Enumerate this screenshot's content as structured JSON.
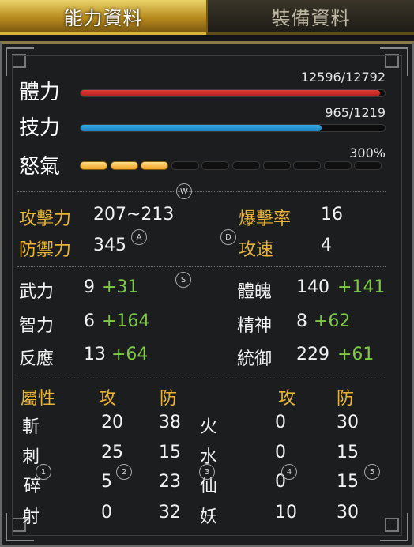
{
  "tabs": [
    {
      "label": "能力資料",
      "active": true
    },
    {
      "label": "裝備資料",
      "active": false
    }
  ],
  "bars": [
    {
      "label": "體力",
      "value": "12596/12792",
      "fraction": 0.985,
      "color": "#e33b3b"
    },
    {
      "label": "技力",
      "value": "965/1219",
      "fraction": 0.792,
      "color": "#37aee8"
    }
  ],
  "rage": {
    "label": "怒氣",
    "value": "300%",
    "segments_total": 10,
    "segments_filled": 3
  },
  "combat": {
    "attack_label": "攻擊力",
    "attack_value": "207~213",
    "crit_label": "爆擊率",
    "crit_value": "16",
    "defense_label": "防禦力",
    "defense_value": "345",
    "speed_label": "攻速",
    "speed_value": "4"
  },
  "attributes": [
    {
      "label": "武力",
      "base": "9",
      "bonus": "+31"
    },
    {
      "label": "體魄",
      "base": "140",
      "bonus": "+141"
    },
    {
      "label": "智力",
      "base": "6",
      "bonus": "+164"
    },
    {
      "label": "精神",
      "base": "8",
      "bonus": "+62"
    },
    {
      "label": "反應",
      "base": "13",
      "bonus": "+64"
    },
    {
      "label": "統御",
      "base": "229",
      "bonus": "+61"
    }
  ],
  "elements": {
    "header": {
      "title": "屬性",
      "atk": "攻",
      "def": "防"
    },
    "left": [
      {
        "name": "斬",
        "atk": "20",
        "def": "38"
      },
      {
        "name": "刺",
        "atk": "25",
        "def": "15"
      },
      {
        "name": "碎",
        "atk": "5",
        "def": "23"
      },
      {
        "name": "射",
        "atk": "0",
        "def": "32"
      }
    ],
    "right": [
      {
        "name": "火",
        "atk": "0",
        "def": "30"
      },
      {
        "name": "水",
        "atk": "0",
        "def": "15"
      },
      {
        "name": "仙",
        "atk": "0",
        "def": "15"
      },
      {
        "name": "妖",
        "atk": "10",
        "def": "30"
      }
    ]
  },
  "hotkeys": {
    "w": "W",
    "a": "A",
    "d": "D",
    "s": "S",
    "k1": "1",
    "k2": "2",
    "k3": "3",
    "k4": "4",
    "k5": "5"
  }
}
